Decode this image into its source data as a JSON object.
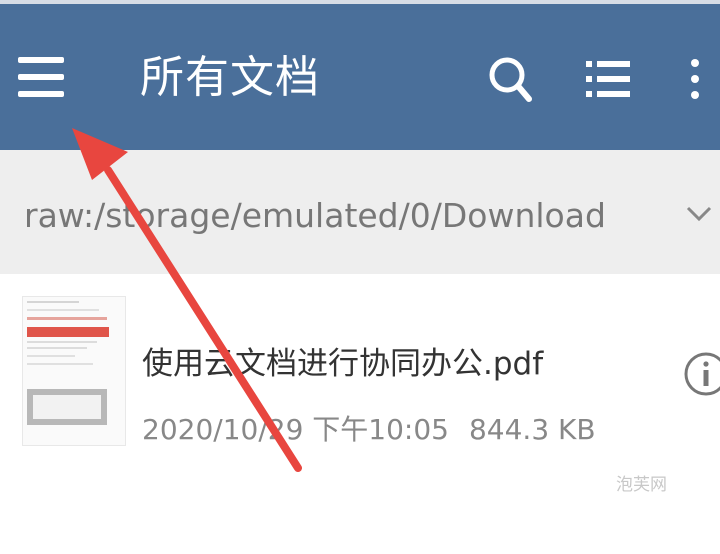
{
  "appbar": {
    "title": "所有文档",
    "background": "#4a6f9a",
    "icons": [
      "hamburger-menu-icon",
      "search-icon",
      "list-view-icon",
      "more-vert-icon"
    ]
  },
  "pathbar": {
    "path": "raw:/storage/emulated/0/Download",
    "icon": "chevron-down-icon"
  },
  "files": [
    {
      "name": "使用云文档进行协同办公.pdf",
      "date": "2020/10/29 下午10:05",
      "size": "844.3 KB",
      "icon": "info-icon"
    }
  ],
  "annotation": {
    "color": "#e8463f"
  },
  "watermark": "泡芙网"
}
